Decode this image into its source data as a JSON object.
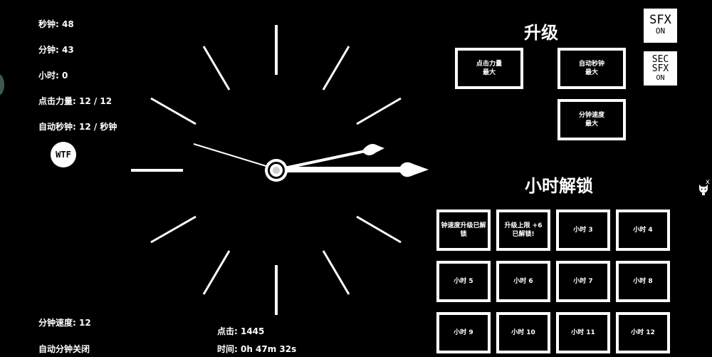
{
  "stats": {
    "seconds": "秒钟: 48",
    "minutes": "分钟: 43",
    "hours": "小时: 0",
    "click_power": "点击力量: 12 / 12",
    "auto_seconds": "自动秒钟: 12 / 秒钟",
    "minute_speed": "分钟速度: 12",
    "auto_minutes": "自动分钟关闭",
    "clicks": "点击: 1445",
    "time": "时间: 0h 47m 32s"
  },
  "wtf_label": "WTF",
  "upgrades": {
    "title": "升级",
    "click_power": "点击力量\n最大",
    "auto_seconds": "自动秒钟\n最大",
    "minute_speed": "分钟速度\n最大"
  },
  "sound": {
    "sfx_line1": "SFX",
    "sfx_line2": "ON",
    "sec_line1": "SEC",
    "sec_line2": "SFX",
    "sec_line3": "ON"
  },
  "unlocks": {
    "title": "小时解锁",
    "items": [
      "钟速度升级已解锁",
      "升级上限 +6\n已解锁!",
      "小时 3",
      "小时 4",
      "小时 5",
      "小时 6",
      "小时 7",
      "小时 8",
      "小时 9",
      "小时 10",
      "小时 11",
      "小时 12"
    ]
  },
  "close_label": "x",
  "icons": {
    "clock": "clock-face-icon",
    "cat": "cat-icon"
  }
}
